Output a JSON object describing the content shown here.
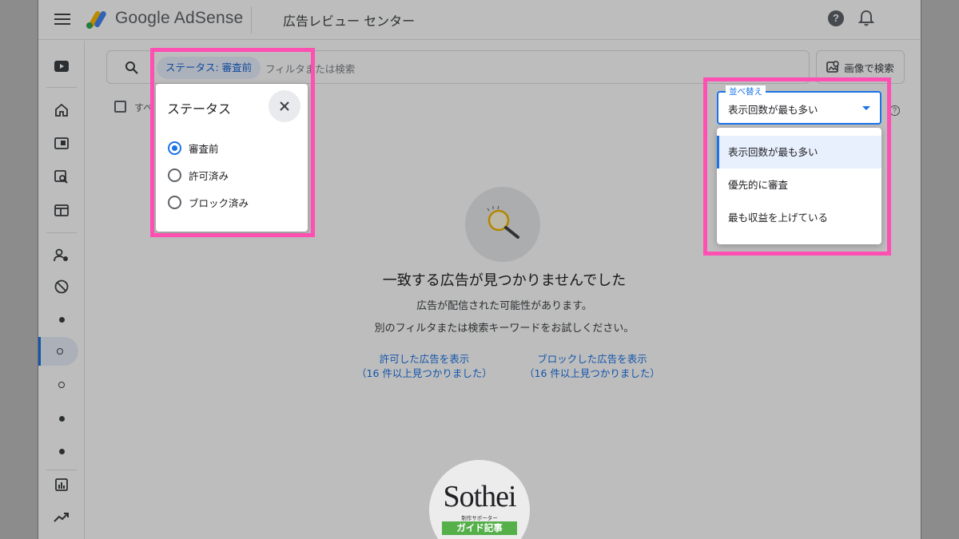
{
  "header": {
    "brand": "Google AdSense",
    "page_title": "広告レビュー センター",
    "help_symbol": "?"
  },
  "sidebar": {
    "items": [
      {
        "icon": "youtube-icon"
      },
      {
        "icon": "home-icon"
      },
      {
        "icon": "panel-icon"
      },
      {
        "icon": "search-page-icon"
      },
      {
        "icon": "layout-icon"
      },
      {
        "icon": "user-settings-icon"
      },
      {
        "icon": "block-icon"
      },
      {
        "icon": "dot-icon"
      },
      {
        "icon": "ring-icon",
        "active": true
      },
      {
        "icon": "ring-icon"
      },
      {
        "icon": "dot-icon"
      },
      {
        "icon": "dot-icon"
      },
      {
        "icon": "bar-chart-icon"
      },
      {
        "icon": "trending-up-icon"
      }
    ]
  },
  "search": {
    "chip_label": "ステータス: 審査前",
    "placeholder": "フィルタまたは検索",
    "image_search_label": "画像で検索"
  },
  "list": {
    "select_all_label": "すべ"
  },
  "status_popup": {
    "title": "ステータス",
    "options": [
      {
        "label": "審査前",
        "selected": true
      },
      {
        "label": "許可済み",
        "selected": false
      },
      {
        "label": "ブロック済み",
        "selected": false
      }
    ]
  },
  "sort": {
    "label": "並べ替え",
    "value": "表示回数が最も多い",
    "options": [
      {
        "label": "表示回数が最も多い",
        "selected": true
      },
      {
        "label": "優先的に審査",
        "selected": false
      },
      {
        "label": "最も収益を上げている",
        "selected": false
      }
    ]
  },
  "empty_state": {
    "title": "一致する広告が見つかりませんでした",
    "line1": "広告が配信された可能性があります。",
    "line2": "別のフィルタまたは検索キーワードをお試しください。",
    "links": [
      {
        "label": "許可した広告を表示",
        "count": "（16 件以上見つかりました）"
      },
      {
        "label": "ブロックした広告を表示",
        "count": "（16 件以上見つかりました）"
      }
    ]
  },
  "watermark": {
    "logo_text": "Sothei",
    "subtitle": "制作サポーター",
    "badge": "ガイド記事"
  },
  "colors": {
    "accent": "#1a73e8",
    "highlight": "#ff4fb3",
    "overlay": "rgba(0,0,0,0.26)"
  }
}
